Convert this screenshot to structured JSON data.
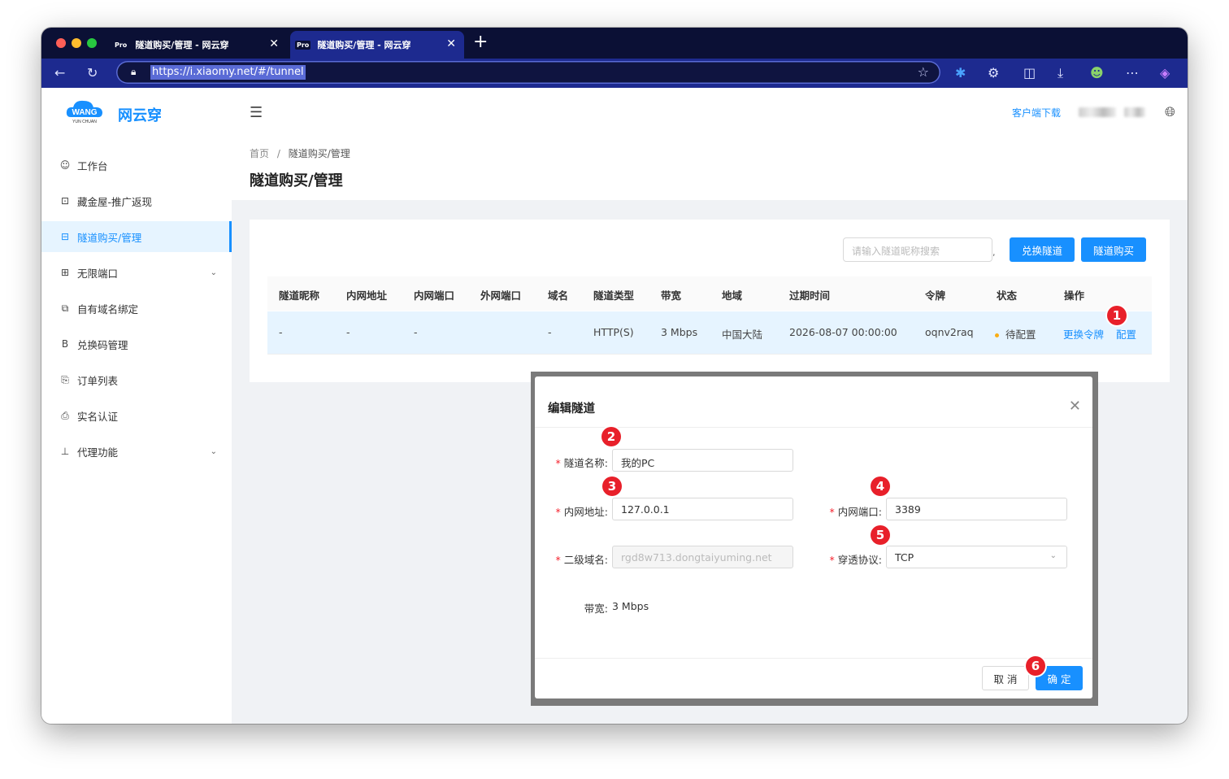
{
  "browser": {
    "tabs": [
      {
        "favicon": "Pro",
        "title": "隧道购买/管理 - 网云穿"
      },
      {
        "favicon": "Pro",
        "title": "隧道购买/管理 - 网云穿"
      }
    ],
    "url": "https://i.xiaomy.net/#/tunnel"
  },
  "app": {
    "logo_text": "WANG",
    "logo_sub": "YUN CHUAN",
    "brand": "网云穿",
    "header_link": "客户端下载"
  },
  "sidebar": {
    "items": [
      {
        "icon": "smile-icon",
        "glyph": "☺",
        "label": "工作台"
      },
      {
        "icon": "gift-icon",
        "glyph": "⊡",
        "label": "藏金屋-推广返现"
      },
      {
        "icon": "tunnel-icon",
        "glyph": "⊟",
        "label": "隧道购买/管理"
      },
      {
        "icon": "ports-icon",
        "glyph": "⊞",
        "label": "无限端口"
      },
      {
        "icon": "domain-icon",
        "glyph": "⧉",
        "label": "自有域名绑定"
      },
      {
        "icon": "code-icon",
        "glyph": "B",
        "label": "兑换码管理"
      },
      {
        "icon": "order-icon",
        "glyph": "⎘",
        "label": "订单列表"
      },
      {
        "icon": "id-icon",
        "glyph": "⎙",
        "label": "实名认证"
      },
      {
        "icon": "proxy-icon",
        "glyph": "⊥",
        "label": "代理功能"
      }
    ]
  },
  "page": {
    "breadcrumb_home": "首页",
    "breadcrumb_sep": "/",
    "breadcrumb_current": "隧道购买/管理",
    "title": "隧道购买/管理",
    "search_placeholder": "请输入隧道昵称搜索",
    "search_comma": ",",
    "btn_exchange": "兑换隧道",
    "btn_buy": "隧道购买"
  },
  "table": {
    "headers": [
      "隧道昵称",
      "内网地址",
      "内网端口",
      "外网端口",
      "域名",
      "隧道类型",
      "带宽",
      "地域",
      "过期时间",
      "令牌",
      "状态",
      "操作"
    ],
    "row": {
      "nickname": "-",
      "local_addr": "-",
      "local_port": "-",
      "remote_port": "",
      "domain": "-",
      "type": "HTTP(S)",
      "bandwidth": "3 Mbps",
      "region": "中国大陆",
      "expire": "2026-08-07 00:00:00",
      "token": "oqnv2raq",
      "status": "待配置",
      "action_replace": "更换令牌",
      "action_config": "配置"
    }
  },
  "modal": {
    "title": "编辑隧道",
    "name_label": "隧道名称:",
    "name_value": "我的PC",
    "addr_label": "内网地址:",
    "addr_value": "127.0.0.1",
    "port_label": "内网端口:",
    "port_value": "3389",
    "subdomain_label": "二级域名:",
    "subdomain_value": "rgd8w713.dongtaiyuming.net",
    "protocol_label": "穿透协议:",
    "protocol_value": "TCP",
    "bandwidth_label": "带宽:",
    "bandwidth_value": "3 Mbps",
    "cancel": "取 消",
    "ok": "确 定"
  },
  "annotations": [
    "1",
    "2",
    "3",
    "4",
    "5",
    "6"
  ],
  "colors": {
    "primary": "#1890ff",
    "badge": "#e8202a",
    "browser_tabbar": "#0b1035",
    "browser_toolbar": "#1d2a8f"
  }
}
